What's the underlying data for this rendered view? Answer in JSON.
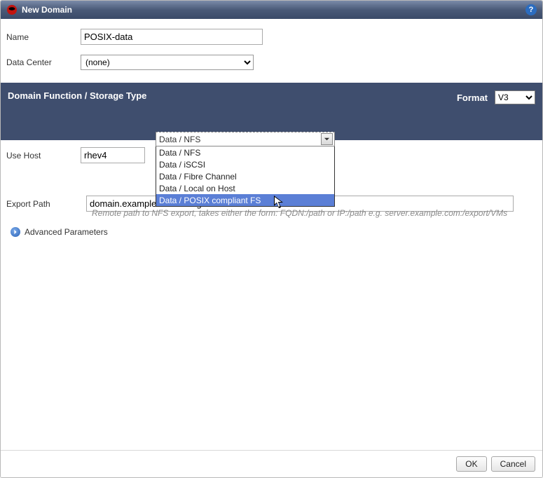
{
  "title": "New Domain",
  "help": "?",
  "fields": {
    "nameLabel": "Name",
    "nameValue": "POSIX-data",
    "dcLabel": "Data Center",
    "dcValue": "(none)",
    "useHostLabel": "Use Host",
    "useHostValue": "rhev4",
    "exportLabel": "Export Path",
    "exportValue": "domain.example.com:/Images/POSIX-data",
    "exportHint": "Remote path to NFS export, takes either the form: FQDN:/path or IP:/path e.g. server.example.com:/export/VMs"
  },
  "darkband": {
    "title": "Domain Function / Storage Type",
    "formatLabel": "Format",
    "formatValue": "V3"
  },
  "storageTypeDropdown": {
    "selected": "Data / NFS",
    "options": [
      "Data / NFS",
      "Data / iSCSI",
      "Data / Fibre Channel",
      "Data / Local on Host",
      "Data / POSIX compliant FS"
    ],
    "highlightIndex": 4
  },
  "advanced": "Advanced Parameters",
  "buttons": {
    "ok": "OK",
    "cancel": "Cancel"
  }
}
